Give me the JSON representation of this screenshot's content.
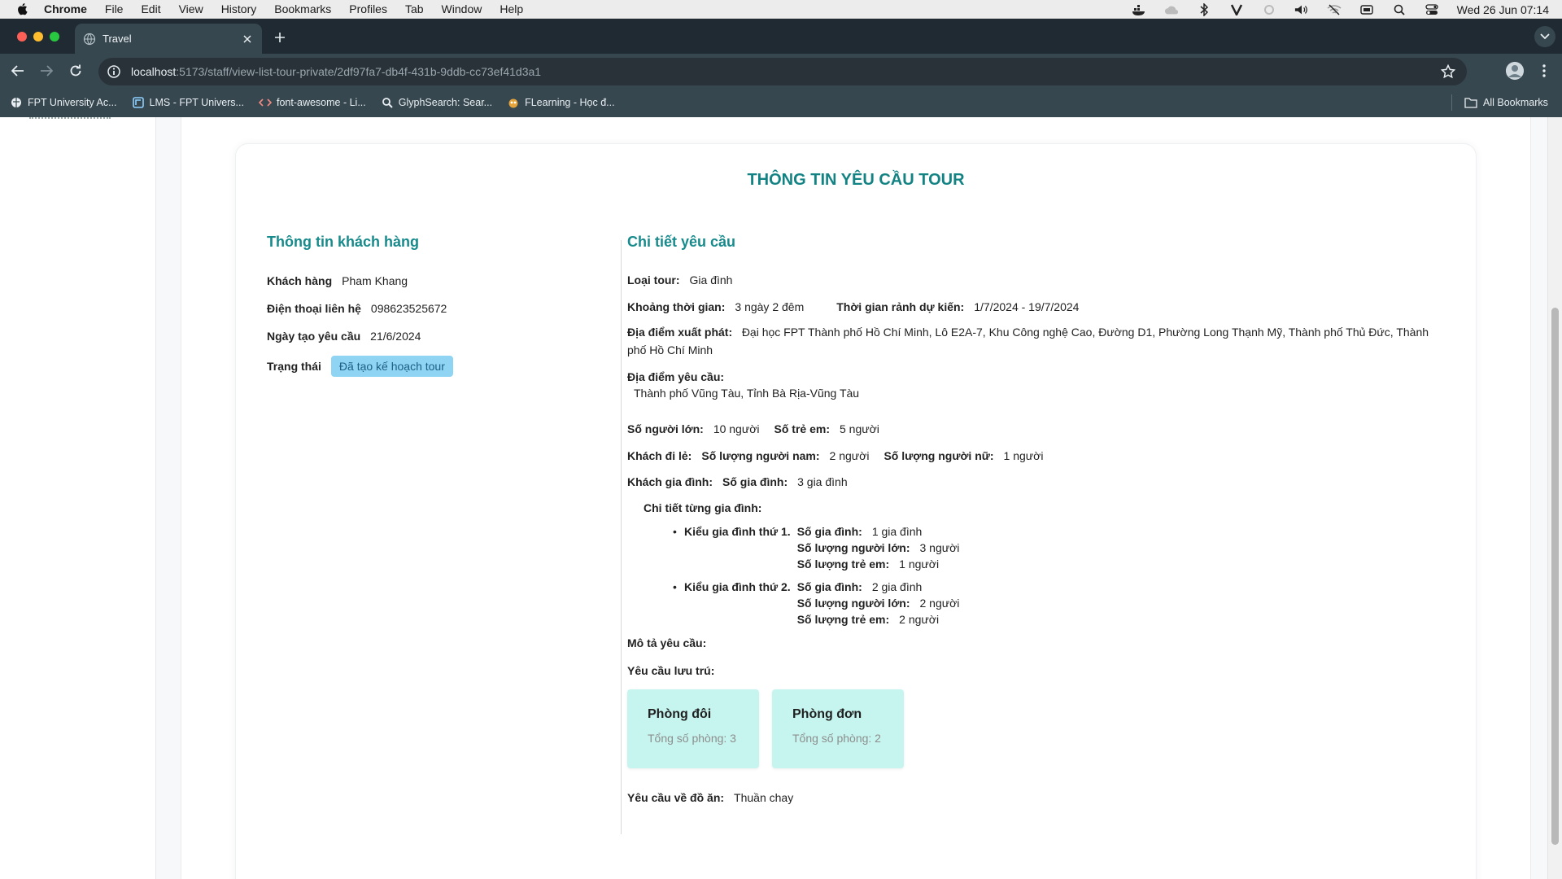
{
  "menubar": {
    "app_name": "Chrome",
    "items": [
      "File",
      "Edit",
      "View",
      "History",
      "Bookmarks",
      "Profiles",
      "Tab",
      "Window",
      "Help"
    ],
    "clock": "Wed 26 Jun  07:14",
    "status_icons": [
      "docker-icon",
      "cloud-icon",
      "bluetooth-icon",
      "v-icon",
      "status-dot-icon",
      "volume-icon",
      "wifi-off-icon",
      "keyboard-icon",
      "search-icon",
      "control-center-icon"
    ]
  },
  "browser": {
    "tab_title": "Travel",
    "url_host": "localhost",
    "url_path": ":5173/staff/view-list-tour-private/2df97fa7-db4f-431b-9ddb-cc73ef41d3a1",
    "bookmarks": [
      "FPT University Ac...",
      "LMS - FPT Univers...",
      "font-awesome - Li...",
      "GlyphSearch: Sear...",
      "FLearning - Học đ..."
    ],
    "all_bookmarks": "All Bookmarks"
  },
  "page": {
    "title": "THÔNG TIN YÊU CẦU TOUR",
    "customer": {
      "section_title": "Thông tin khách hàng",
      "name_label": "Khách hàng",
      "name": "Pham Khang",
      "phone_label": "Điện thoại liên hệ",
      "phone": "098623525672",
      "created_label": "Ngày tạo yêu cầu",
      "created": "21/6/2024",
      "status_label": "Trạng thái",
      "status": "Đã tạo kế hoạch tour"
    },
    "details": {
      "section_title": "Chi tiết yêu cầu",
      "tour_type_label": "Loại tour:",
      "tour_type": "Gia đình",
      "duration_label": "Khoảng thời gian:",
      "duration": "3 ngày 2 đêm",
      "free_time_label": "Thời gian rảnh dự kiến:",
      "free_time": "1/7/2024 - 19/7/2024",
      "departure_label": "Địa điểm xuất phát:",
      "departure": "Đại học FPT Thành phố Hồ Chí Minh, Lô E2A-7, Khu Công nghệ Cao, Đường D1, Phường Long Thạnh Mỹ, Thành phố Thủ Đức, Thành phố Hồ Chí Minh",
      "destination_label": "Địa điểm yêu cầu:",
      "destination": "Thành phố Vũng Tàu, Tỉnh Bà Rịa-Vũng Tàu",
      "adults_label": "Số người lớn:",
      "adults": "10 người",
      "children_label": "Số trẻ em:",
      "children": "5 người",
      "solo_label": "Khách đi lẻ:",
      "male_label": "Số lượng người nam:",
      "male": "2 người",
      "female_label": "Số lượng người nữ:",
      "female": "1 người",
      "family_guest_label": "Khách gia đình:",
      "family_count_label": "Số gia đình:",
      "family_count": "3 gia đình",
      "family_detail_label": "Chi tiết từng gia đình:",
      "families": [
        {
          "label": "Kiểu gia đình thứ 1.",
          "count_label": "Số gia đình:",
          "count": "1 gia đình",
          "adults_label": "Số lượng người lớn:",
          "adults": "3 người",
          "children_label": "Số lượng trẻ em:",
          "children": "1 người"
        },
        {
          "label": "Kiểu gia đình thứ 2.",
          "count_label": "Số gia đình:",
          "count": "2 gia đình",
          "adults_label": "Số lượng người lớn:",
          "adults": "2 người",
          "children_label": "Số lượng trẻ em:",
          "children": "2 người"
        }
      ],
      "description_label": "Mô tả yêu cầu:",
      "lodging_label": "Yêu cầu lưu trú:",
      "rooms": [
        {
          "name": "Phòng đôi",
          "count": "Tổng số phòng: 3"
        },
        {
          "name": "Phòng đơn",
          "count": "Tổng số phòng: 2"
        }
      ],
      "food_label": "Yêu cầu về đồ ăn:",
      "food": "Thuần chay"
    }
  },
  "colors": {
    "accent": "#178a8b",
    "status_bg": "#8fd4f2",
    "room_card_bg": "#c6f5ef",
    "chrome_frame": "#37474f"
  }
}
